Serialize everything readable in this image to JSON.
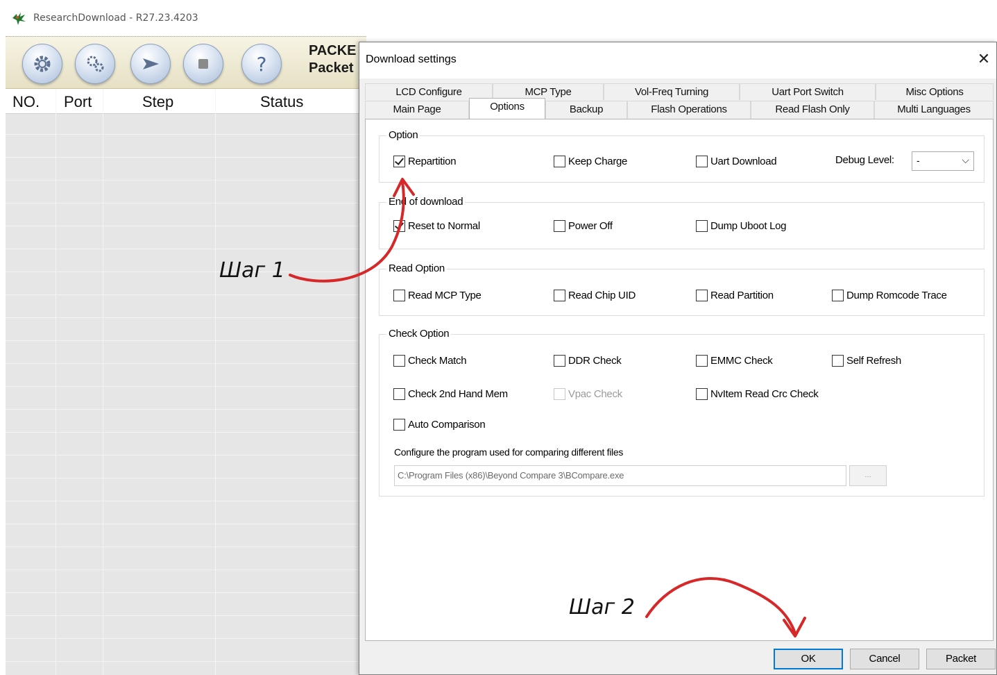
{
  "app": {
    "title": "ResearchDownload - R27.23.4203",
    "packet_line1": "PACKE",
    "packet_line2": "Packet",
    "toolbar": [
      {
        "icon": "gear-icon"
      },
      {
        "icon": "gears-icon"
      },
      {
        "icon": "play-arrow-icon"
      },
      {
        "icon": "stop-icon"
      },
      {
        "icon": "help-icon"
      }
    ],
    "columns": [
      "NO.",
      "Port",
      "Step",
      "Status"
    ]
  },
  "dialog": {
    "title": "Download settings",
    "close_glyph": "✕",
    "tabs_row1": [
      "LCD Configure",
      "MCP Type",
      "Vol-Freq Turning",
      "Uart Port Switch",
      "Misc Options"
    ],
    "tabs_row2": [
      "Main Page",
      "Options",
      "Backup",
      "Flash Operations",
      "Read Flash Only",
      "Multi Languages"
    ],
    "selected_tab": "Options",
    "groups": {
      "option": {
        "label": "Option",
        "items": [
          {
            "label": "Repartition",
            "checked": true
          },
          {
            "label": "Keep Charge",
            "checked": false
          },
          {
            "label": "Uart Download",
            "checked": false
          }
        ],
        "debug_label": "Debug Level:",
        "debug_value": "-"
      },
      "end_of_download": {
        "label": "End of download",
        "items": [
          {
            "label": "Reset to Normal",
            "checked": true
          },
          {
            "label": "Power Off",
            "checked": false
          },
          {
            "label": "Dump Uboot Log",
            "checked": false
          }
        ]
      },
      "read_option": {
        "label": "Read Option",
        "items": [
          {
            "label": "Read MCP Type",
            "checked": false
          },
          {
            "label": "Read Chip UID",
            "checked": false
          },
          {
            "label": "Read Partition",
            "checked": false
          },
          {
            "label": "Dump Romcode Trace",
            "checked": false
          }
        ]
      },
      "check_option": {
        "label": "Check Option",
        "items": [
          {
            "label": "Check Match",
            "checked": false
          },
          {
            "label": "DDR Check",
            "checked": false
          },
          {
            "label": "EMMC Check",
            "checked": false
          },
          {
            "label": "Self Refresh",
            "checked": false
          },
          {
            "label": "Check 2nd Hand Mem",
            "checked": false
          },
          {
            "label": "Vpac Check",
            "checked": false,
            "disabled": true
          },
          {
            "label": "NvItem Read Crc Check",
            "checked": false
          },
          {
            "label": "Auto Comparison",
            "checked": false
          }
        ],
        "compare_label": "Configure the program used for comparing different files",
        "compare_path": "C:\\Program Files (x86)\\Beyond Compare 3\\BCompare.exe",
        "browse_label": "..."
      }
    },
    "buttons": {
      "ok": "OK",
      "cancel": "Cancel",
      "packet": "Packet"
    }
  },
  "annotations": {
    "step1": "Шаг 1",
    "step2": "Шаг 2",
    "arrow_color": "#d62828"
  }
}
